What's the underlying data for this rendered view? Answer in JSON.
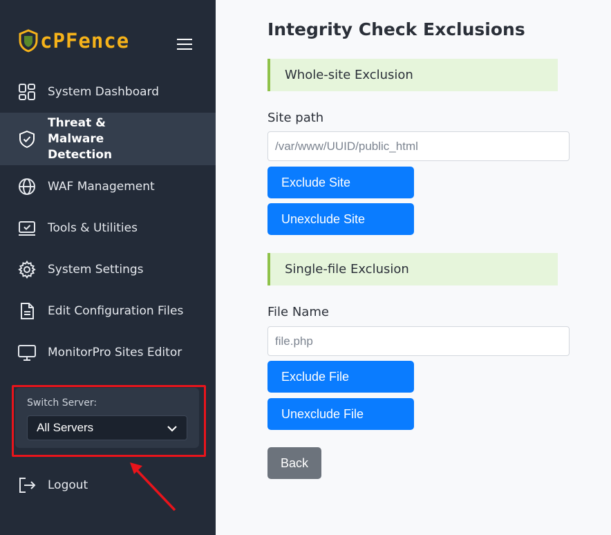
{
  "sidebar": {
    "logo_text": "cPFence",
    "items": [
      {
        "label": "System Dashboard",
        "icon": "dashboard-grid-icon"
      },
      {
        "label": "Threat & Malware Detection",
        "icon": "shield-check-icon"
      },
      {
        "label": "WAF Management",
        "icon": "globe-icon"
      },
      {
        "label": "Tools & Utilities",
        "icon": "monitor-check-icon"
      },
      {
        "label": "System Settings",
        "icon": "gear-icon"
      },
      {
        "label": "Edit Configuration Files",
        "icon": "document-icon"
      },
      {
        "label": "MonitorPro Sites Editor",
        "icon": "desktop-icon"
      }
    ],
    "switch_server": {
      "label": "Switch Server:",
      "selected": "All Servers"
    },
    "logout_label": "Logout"
  },
  "main": {
    "title": "Integrity Check Exclusions",
    "whole_site": {
      "header": "Whole-site Exclusion",
      "field_label": "Site path",
      "placeholder": "/var/www/UUID/public_html",
      "exclude_label": "Exclude Site",
      "unexclude_label": "Unexclude Site"
    },
    "single_file": {
      "header": "Single-file Exclusion",
      "field_label": "File Name",
      "placeholder": "file.php",
      "exclude_label": "Exclude File",
      "unexclude_label": "Unexclude File"
    },
    "back_label": "Back"
  },
  "colors": {
    "sidebar_bg": "#232b38",
    "active_bg": "#343e4d",
    "logo": "#f5b21a",
    "primary_button": "#0a7cff",
    "secondary_button": "#6c737c",
    "section_bg": "#e6f5db",
    "section_accent": "#8fc24a",
    "highlight": "#e8141b"
  }
}
